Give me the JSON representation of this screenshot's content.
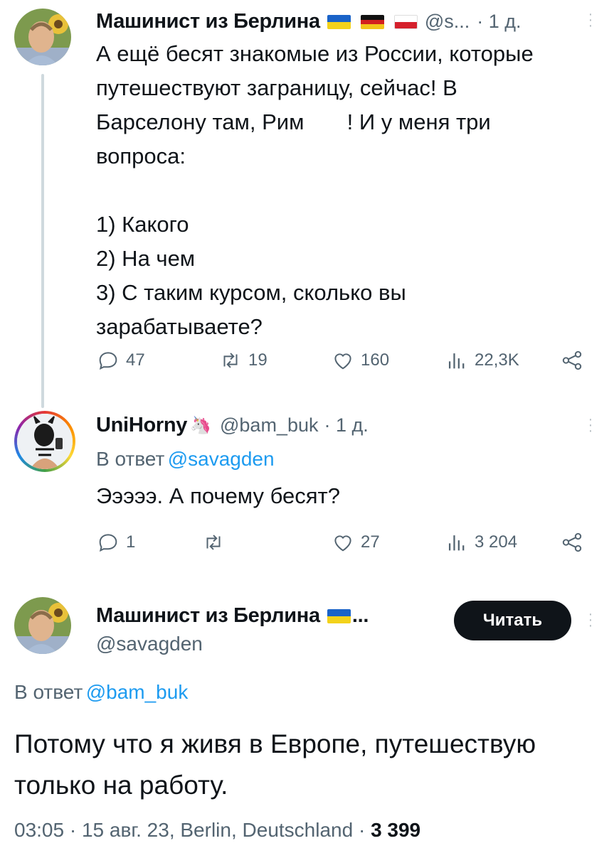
{
  "colors": {
    "text": "#0f1419",
    "secondary": "#536471",
    "link": "#1d9bf0",
    "thread_line": "#cfd9de",
    "button_bg": "#0f1419"
  },
  "tweet1": {
    "author_name": "Машинист из Берлина",
    "flags": [
      "flag-ukraine",
      "flag-germany",
      "flag-poland"
    ],
    "handle": "@s...",
    "time": "· 1 д.",
    "text_lines": [
      "А ещё бесят знакомые из России, которые",
      "путешествуют заграницу, сейчас! В",
      "Барселону там, Рим       ! И у меня три",
      "вопроса:",
      "",
      "1) Какого",
      "2) На чем",
      "3) С таким курсом, сколько вы",
      "зарабатываете?"
    ],
    "replies": "47",
    "retweets": "19",
    "likes": "160",
    "views": "22,3K"
  },
  "tweet2": {
    "author_name": "UniHorny",
    "emoji": "🦄",
    "handle": "@bam_buk",
    "time": "· 1 д.",
    "reply_prefix": "В ответ",
    "reply_to": "@savagden",
    "text": "Эээээ. А почему бесят?",
    "replies": "1",
    "retweets": "",
    "likes": "27",
    "views": "3 204"
  },
  "tweet3": {
    "author_name": "Машинист из Берлина",
    "name_suffix": "...",
    "handle": "@savagden",
    "follow_label": "Читать",
    "reply_prefix": "В ответ",
    "reply_to": "@bam_buk",
    "text_lines": [
      "Потому что я живя в Европе, путешествую",
      "только на работу."
    ],
    "timestamp": "03:05 · 15 авг. 23, Berlin, Deutschland ·",
    "views_count": "3 399"
  }
}
